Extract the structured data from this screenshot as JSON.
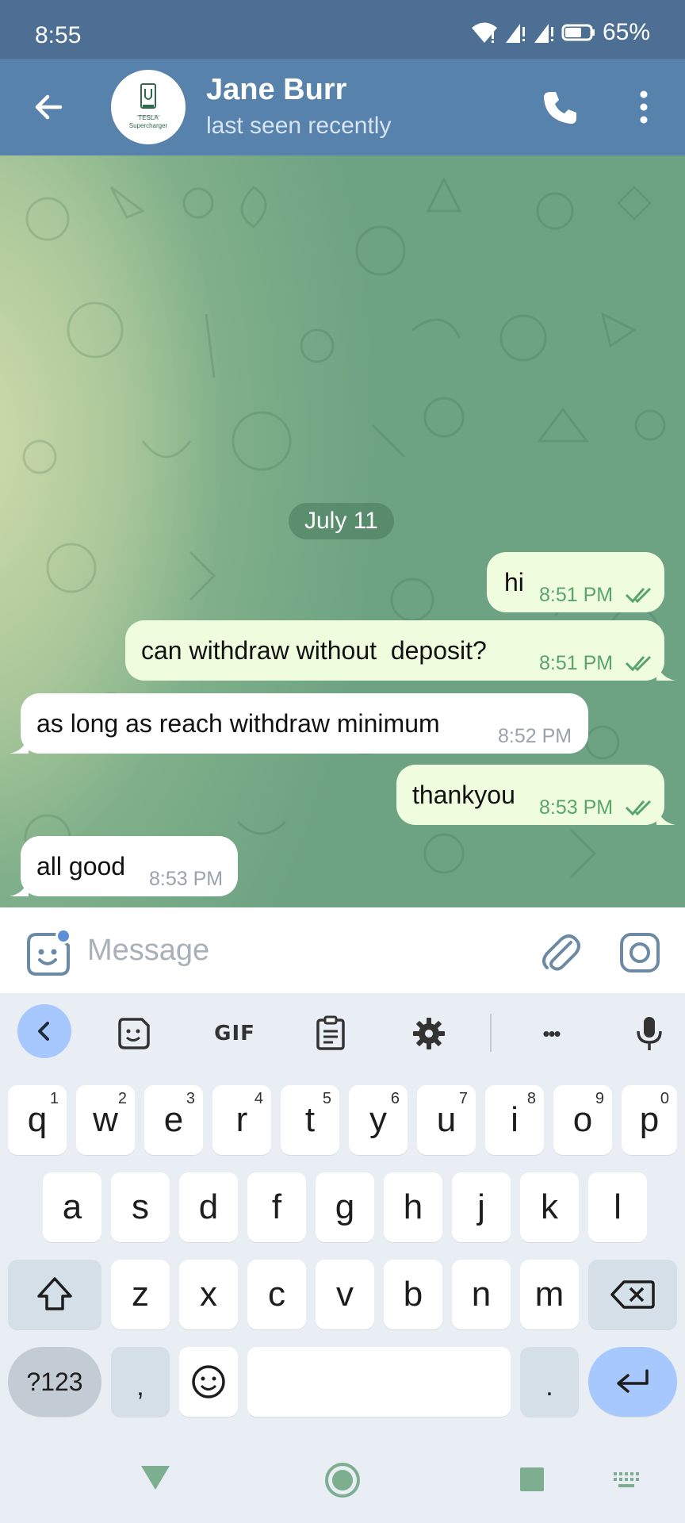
{
  "status_bar": {
    "time": "8:55",
    "battery": "65%"
  },
  "header": {
    "contact_name": "Jane Burr",
    "contact_status": "last seen recently",
    "avatar_text": "TESLA Supercharger"
  },
  "chat": {
    "date_separator": "July 11",
    "messages": [
      {
        "direction": "outgoing",
        "text": "hi",
        "time": "8:51 PM",
        "read": true
      },
      {
        "direction": "outgoing",
        "text": "can withdraw without  deposit?",
        "time": "8:51 PM",
        "read": true
      },
      {
        "direction": "incoming",
        "text": "as long as reach withdraw minimum",
        "time": "8:52 PM"
      },
      {
        "direction": "outgoing",
        "text": "thankyou",
        "time": "8:53 PM",
        "read": true
      },
      {
        "direction": "incoming",
        "text": "all good",
        "time": "8:53 PM"
      }
    ]
  },
  "compose": {
    "placeholder": "Message"
  },
  "keyboard": {
    "toolbar": {
      "gif_label": "GIF",
      "more_label": "•••"
    },
    "row1": [
      {
        "key": "q",
        "alt": "1"
      },
      {
        "key": "w",
        "alt": "2"
      },
      {
        "key": "e",
        "alt": "3"
      },
      {
        "key": "r",
        "alt": "4"
      },
      {
        "key": "t",
        "alt": "5"
      },
      {
        "key": "y",
        "alt": "6"
      },
      {
        "key": "u",
        "alt": "7"
      },
      {
        "key": "i",
        "alt": "8"
      },
      {
        "key": "o",
        "alt": "9"
      },
      {
        "key": "p",
        "alt": "0"
      }
    ],
    "row2": [
      "a",
      "s",
      "d",
      "f",
      "g",
      "h",
      "j",
      "k",
      "l"
    ],
    "row3": [
      "z",
      "x",
      "c",
      "v",
      "b",
      "n",
      "m"
    ],
    "symbols_label": "?123",
    "comma_label": ",",
    "period_label": "."
  },
  "colors": {
    "header_bg": "#5682ac",
    "status_bg": "#4d6f94",
    "outgoing_bubble": "#effdde",
    "incoming_bubble": "#ffffff",
    "read_check": "#5aa46b",
    "keyboard_accent": "#a6c8ff"
  },
  "icons": [
    "back-arrow-icon",
    "phone-icon",
    "more-vert-icon",
    "sticker-emoji-icon",
    "paperclip-icon",
    "camera-icon",
    "chevron-left-icon",
    "sticker-icon",
    "clipboard-icon",
    "gear-icon",
    "microphone-icon",
    "shift-icon",
    "backspace-icon",
    "smiley-icon",
    "enter-icon",
    "nav-back-icon",
    "nav-home-icon",
    "nav-recents-icon",
    "keyboard-switch-icon"
  ]
}
